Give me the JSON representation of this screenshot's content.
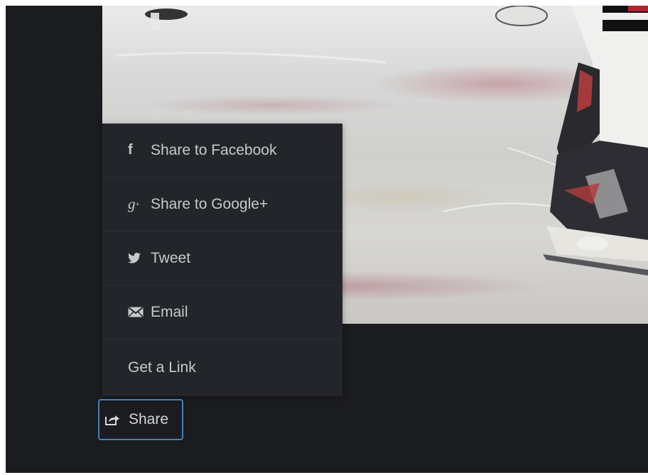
{
  "share_menu": {
    "items": [
      {
        "label": "Share to Facebook",
        "icon": "facebook-icon"
      },
      {
        "label": "Share to Google+",
        "icon": "google-plus-icon"
      },
      {
        "label": "Tweet",
        "icon": "twitter-icon"
      },
      {
        "label": "Email",
        "icon": "email-icon"
      },
      {
        "label": "Get a Link",
        "icon": ""
      }
    ]
  },
  "share_button": {
    "label": "Share",
    "icon": "share-icon",
    "focus_color": "#4a7fb3"
  },
  "colors": {
    "background": "#1b1c1f",
    "menu_background": "#23252a",
    "menu_text": "#c7c9cc"
  }
}
